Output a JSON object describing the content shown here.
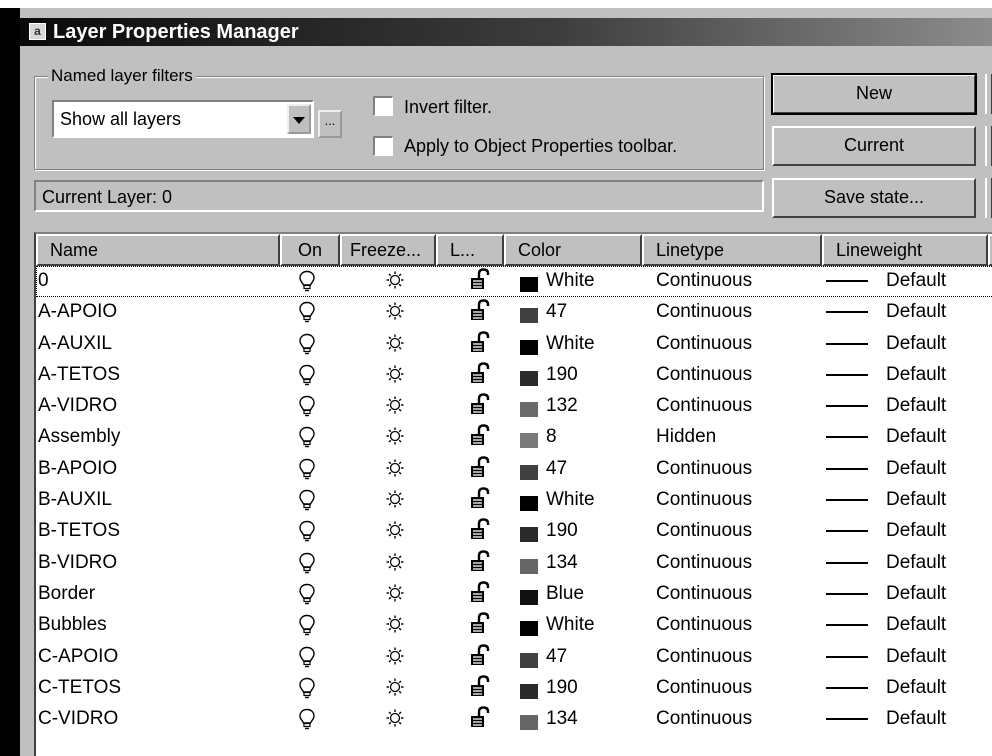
{
  "window": {
    "title": "Layer Properties Manager",
    "icon": "a"
  },
  "filters": {
    "legend": "Named layer filters",
    "selected": "Show all layers",
    "more_button": "...",
    "invert_label": "Invert filter.",
    "apply_label": "Apply to Object Properties toolbar.",
    "invert_checked": false,
    "apply_checked": false
  },
  "status": {
    "current_layer": "Current Layer:  0"
  },
  "buttons": {
    "new": "New",
    "current": "Current",
    "save_state": "Save state..."
  },
  "columns": [
    "Name",
    "On",
    "Freeze...",
    "L...",
    "Color",
    "Linetype",
    "Lineweight"
  ],
  "layers": [
    {
      "name": "0",
      "color": "White",
      "swatch": "#000000",
      "linetype": "Continuous",
      "lineweight": "Default"
    },
    {
      "name": "A-APOIO",
      "color": "47",
      "swatch": "#404040",
      "linetype": "Continuous",
      "lineweight": "Default"
    },
    {
      "name": "A-AUXIL",
      "color": "White",
      "swatch": "#000000",
      "linetype": "Continuous",
      "lineweight": "Default"
    },
    {
      "name": "A-TETOS",
      "color": "190",
      "swatch": "#2a2a2a",
      "linetype": "Continuous",
      "lineweight": "Default"
    },
    {
      "name": "A-VIDRO",
      "color": "132",
      "swatch": "#6a6a6a",
      "linetype": "Continuous",
      "lineweight": "Default"
    },
    {
      "name": "Assembly",
      "color": "8",
      "swatch": "#7a7a7a",
      "linetype": "Hidden",
      "lineweight": "Default"
    },
    {
      "name": "B-APOIO",
      "color": "47",
      "swatch": "#404040",
      "linetype": "Continuous",
      "lineweight": "Default"
    },
    {
      "name": "B-AUXIL",
      "color": "White",
      "swatch": "#000000",
      "linetype": "Continuous",
      "lineweight": "Default"
    },
    {
      "name": "B-TETOS",
      "color": "190",
      "swatch": "#2a2a2a",
      "linetype": "Continuous",
      "lineweight": "Default"
    },
    {
      "name": "B-VIDRO",
      "color": "134",
      "swatch": "#666666",
      "linetype": "Continuous",
      "lineweight": "Default"
    },
    {
      "name": "Border",
      "color": "Blue",
      "swatch": "#111111",
      "linetype": "Continuous",
      "lineweight": "Default"
    },
    {
      "name": "Bubbles",
      "color": "White",
      "swatch": "#000000",
      "linetype": "Continuous",
      "lineweight": "Default"
    },
    {
      "name": "C-APOIO",
      "color": "47",
      "swatch": "#404040",
      "linetype": "Continuous",
      "lineweight": "Default"
    },
    {
      "name": "C-TETOS",
      "color": "190",
      "swatch": "#2a2a2a",
      "linetype": "Continuous",
      "lineweight": "Default"
    },
    {
      "name": "C-VIDRO",
      "color": "134",
      "swatch": "#666666",
      "linetype": "Continuous",
      "lineweight": "Default"
    }
  ],
  "icons": {
    "on": "lightbulb-on-icon",
    "freeze": "sun-thawed-icon",
    "lock": "padlock-unlocked-icon"
  }
}
